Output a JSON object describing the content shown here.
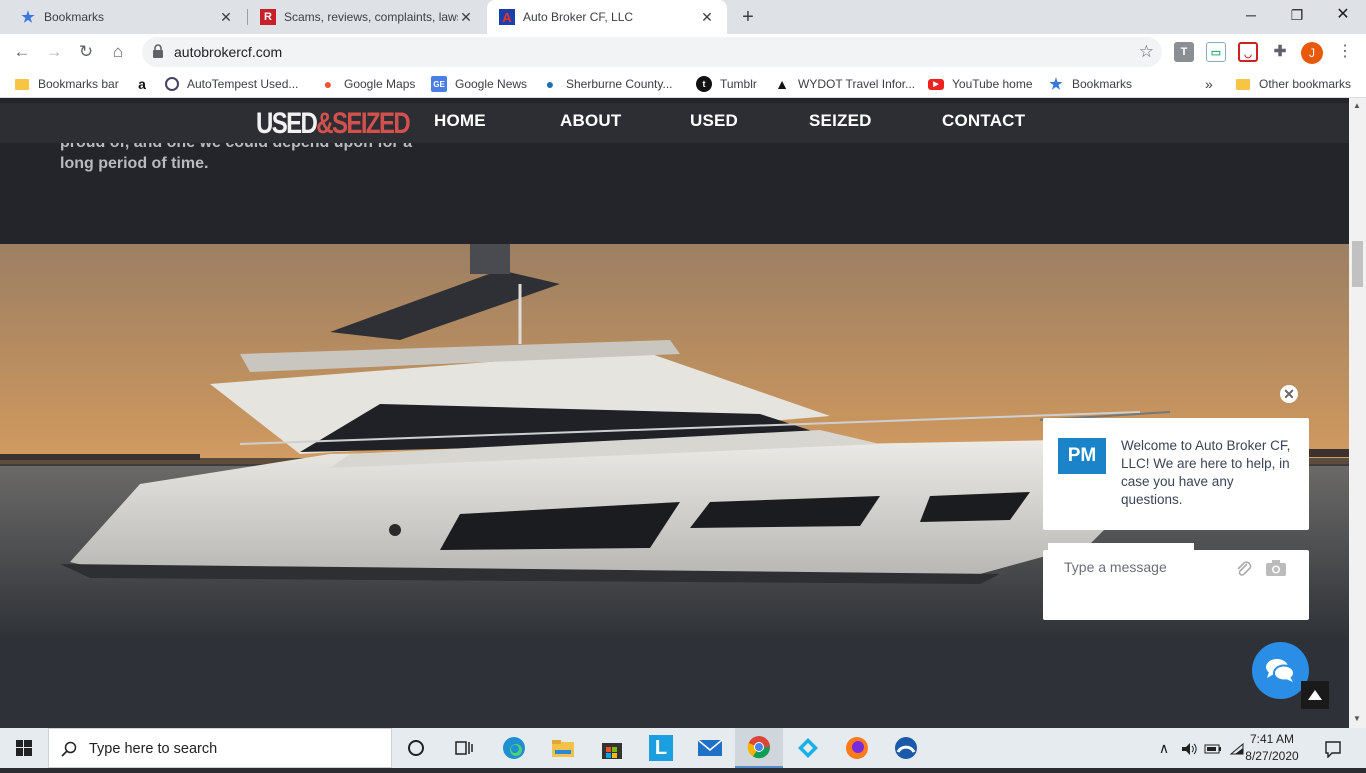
{
  "browser": {
    "tabs": [
      {
        "title": "Bookmarks",
        "favicon": "bookmark-star-icon",
        "active": false
      },
      {
        "title": "Scams, reviews, complaints, lawsu",
        "favicon": "ripoff-report-icon",
        "active": false
      },
      {
        "title": "Auto Broker CF, LLC",
        "favicon": "autobroker-a-icon",
        "active": true
      }
    ],
    "url": "autobrokercf.com",
    "profile_initial": "J",
    "bookmarks": [
      {
        "label": "Bookmarks bar",
        "icon": "folder-icon"
      },
      {
        "label": "",
        "icon": "amazon-icon"
      },
      {
        "label": "AutoTempest Used...",
        "icon": "autotempest-icon"
      },
      {
        "label": "Google Maps",
        "icon": "maps-pin-icon"
      },
      {
        "label": "Google News",
        "icon": "google-news-icon"
      },
      {
        "label": "Sherburne County...",
        "icon": "drupal-icon"
      },
      {
        "label": "Tumblr",
        "icon": "tumblr-icon"
      },
      {
        "label": "WYDOT Travel Infor...",
        "icon": "wydot-icon"
      },
      {
        "label": "YouTube home",
        "icon": "youtube-icon"
      },
      {
        "label": "Bookmarks",
        "icon": "star-icon"
      }
    ],
    "overflow": "»",
    "other_bookmarks": "Other bookmarks"
  },
  "site": {
    "logo_part1": "USED",
    "logo_part2": "&SEIZED",
    "nav": [
      "HOME",
      "ABOUT",
      "USED",
      "SEIZED",
      "CONTACT"
    ],
    "hero_text_line1": "proud of, and one we could depend upon for a",
    "hero_text_line2": "long period of time."
  },
  "chat": {
    "avatar": "PM",
    "message": "Welcome to Auto Broker CF, LLC! We are here to help, in case you have any questions.",
    "input_placeholder": "Type a message",
    "accent": "#2a8de6"
  },
  "taskbar": {
    "search_placeholder": "Type here to search",
    "apps": [
      "cortana-icon",
      "task-view-icon",
      "edge-icon",
      "file-explorer-icon",
      "store-icon",
      "l-app-icon",
      "mail-icon",
      "chrome-icon",
      "kodi-icon",
      "firefox-icon",
      "app-icon"
    ],
    "time": "7:41 AM",
    "date": "8/27/2020"
  }
}
